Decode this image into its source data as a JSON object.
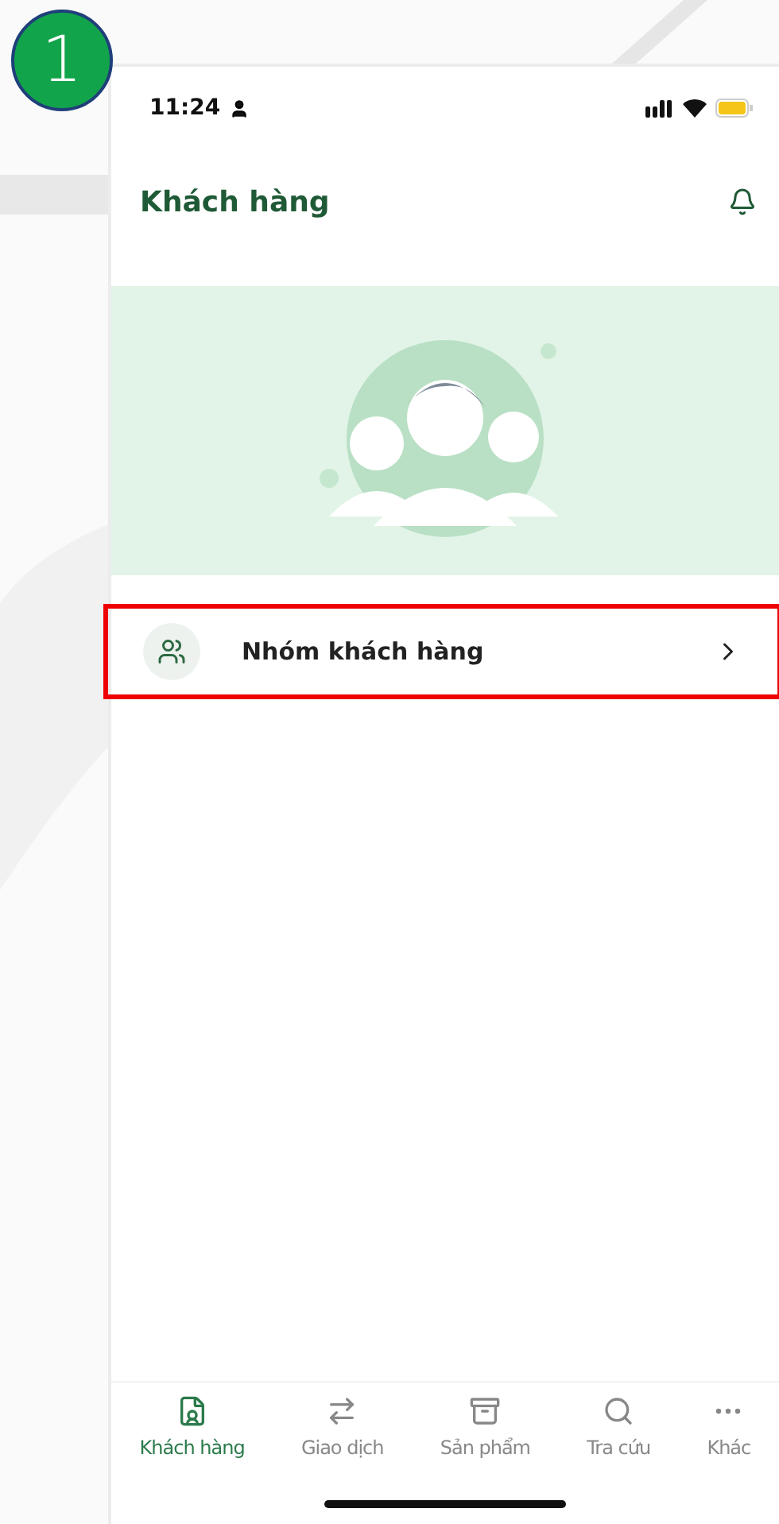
{
  "step_badge": "1",
  "status_bar": {
    "time": "11:24"
  },
  "header": {
    "title": "Khách hàng"
  },
  "menu_items": [
    {
      "label": "Nhóm khách hàng",
      "highlighted": true
    }
  ],
  "tab_bar": [
    {
      "label": "Khách hàng",
      "selected": true
    },
    {
      "label": "Giao dịch",
      "selected": false
    },
    {
      "label": "Sản phẩm",
      "selected": false
    },
    {
      "label": "Tra cứu",
      "selected": false
    },
    {
      "label": "Khác",
      "selected": false
    }
  ]
}
